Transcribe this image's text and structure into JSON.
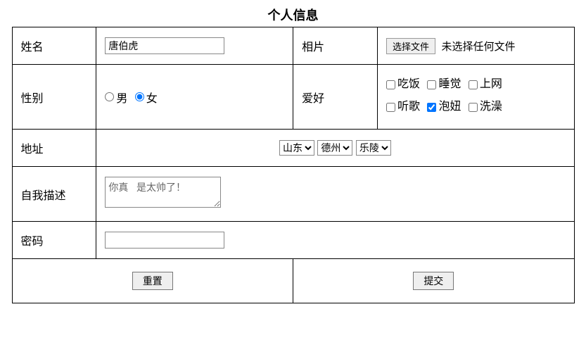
{
  "title": "个人信息",
  "rows": {
    "name": {
      "label": "姓名",
      "value": "唐伯虎"
    },
    "photo": {
      "label": "相片",
      "button": "选择文件",
      "status": "未选择任何文件"
    },
    "gender": {
      "label": "性别",
      "options": [
        {
          "label": "男",
          "checked": false
        },
        {
          "label": "女",
          "checked": true
        }
      ]
    },
    "hobby": {
      "label": "爱好",
      "options": [
        {
          "label": "吃饭",
          "checked": false
        },
        {
          "label": "睡觉",
          "checked": false
        },
        {
          "label": "上网",
          "checked": false
        },
        {
          "label": "听歌",
          "checked": false
        },
        {
          "label": "泡妞",
          "checked": true
        },
        {
          "label": "洗澡",
          "checked": false
        }
      ]
    },
    "address": {
      "label": "地址",
      "selects": [
        "山东",
        "德州",
        "乐陵"
      ]
    },
    "description": {
      "label": "自我描述",
      "value": "你真   是太帅了！"
    },
    "password": {
      "label": "密码",
      "value": ""
    }
  },
  "buttons": {
    "reset": "重置",
    "submit": "提交"
  }
}
